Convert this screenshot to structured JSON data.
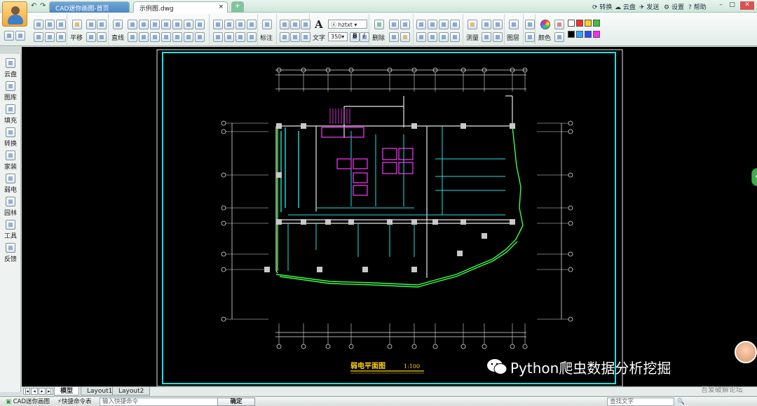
{
  "titlebar": {
    "tabs": [
      {
        "label": "CAD迷你画图-首页"
      },
      {
        "label": "示例图.dwg",
        "close": "×"
      }
    ],
    "add_tab": "+",
    "menu": [
      "转换",
      "云盘",
      "发送",
      "设置",
      "帮助"
    ],
    "window_controls": [
      "–",
      "□"
    ]
  },
  "ribbon": {
    "edit_label": "平移",
    "draw_label": "直线",
    "annotate_label": "标注",
    "text_label": "文字",
    "font_name": "hztxt",
    "font_size": "350",
    "bold": "B",
    "italic": "I",
    "delete_label": "删除",
    "measure_label": "测量",
    "layer_label": "图层",
    "color_label": "颜色",
    "swatch_colors": [
      "#ffffff",
      "#ff2a2a",
      "#ffd21a",
      "#3fbf3f",
      "#000000",
      "#2aa7ff",
      "#2a4bff",
      "#ff2aff"
    ]
  },
  "sidebar": {
    "items": [
      {
        "label": "云盘",
        "icon": "cloud-icon"
      },
      {
        "label": "图库",
        "icon": "gallery-icon"
      },
      {
        "label": "填充",
        "icon": "hatch-icon"
      },
      {
        "label": "转换",
        "icon": "convert-icon"
      },
      {
        "label": "家装",
        "icon": "home-decor-icon"
      },
      {
        "label": "弱电",
        "icon": "low-voltage-icon"
      },
      {
        "label": "园林",
        "icon": "garden-icon"
      },
      {
        "label": "工具",
        "icon": "tools-icon"
      },
      {
        "label": "反馈",
        "icon": "feedback-icon"
      }
    ]
  },
  "drawing": {
    "title": "弱电平面图",
    "scale": "1:100"
  },
  "layout_tabs": [
    "模型",
    "Layout1",
    "Layout2"
  ],
  "statusbar": {
    "app_name": "CAD迷你画图",
    "shortcut_label": "快捷命令表",
    "command_placeholder": "输入快捷命令",
    "ok_label": "确定",
    "search_placeholder": "查找文字"
  },
  "watermark": {
    "text": "Python爬虫数据分析挖掘",
    "forum": "吾爱破解论坛"
  }
}
